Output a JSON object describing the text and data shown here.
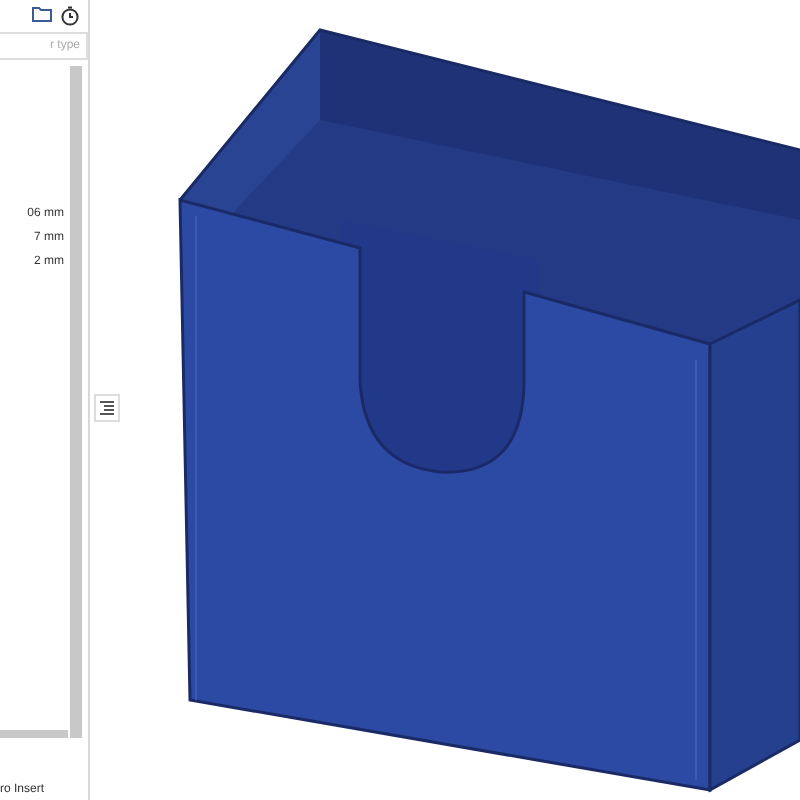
{
  "panel": {
    "search": {
      "placeholder": "r type"
    },
    "measures": [
      "06 mm",
      "7 mm",
      "2 mm"
    ],
    "footer": "ro Insert"
  }
}
